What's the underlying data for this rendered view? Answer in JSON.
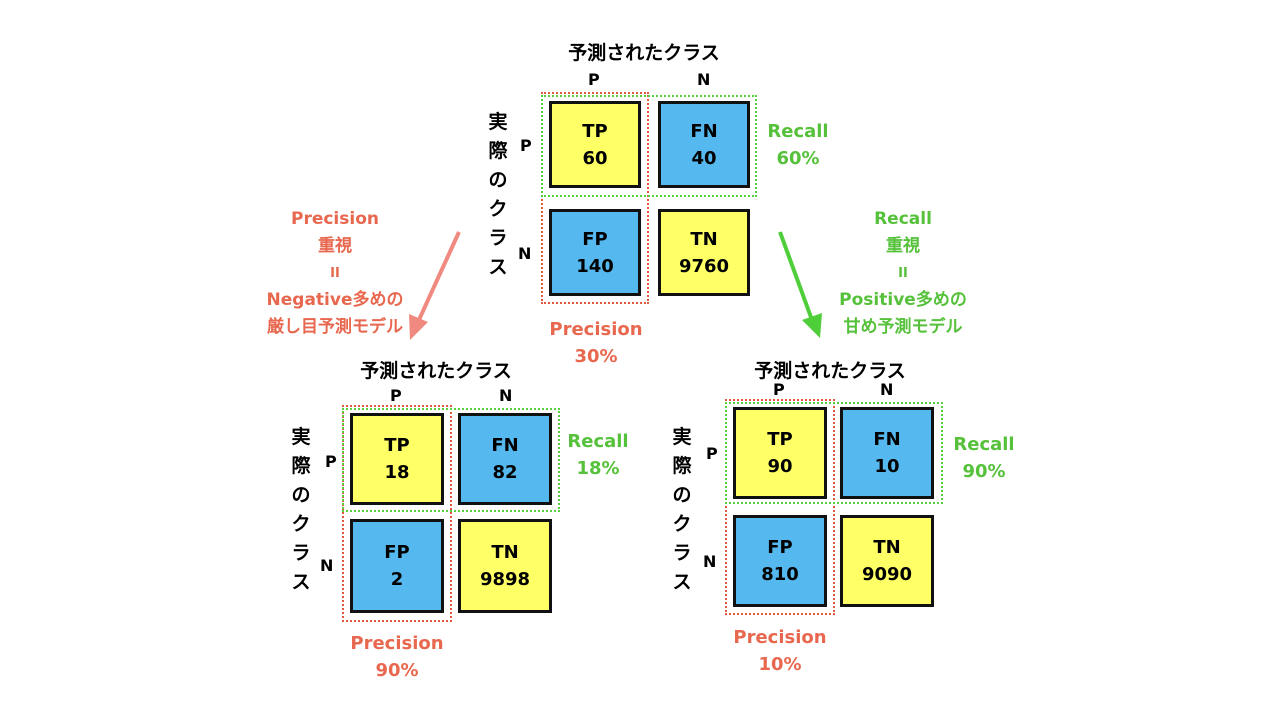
{
  "colors": {
    "yellow": "#ffff66",
    "blue": "#55b9ef",
    "recall_green": "#56c13a",
    "precision_red": "#e8684f",
    "arrow_red": "#f08a80",
    "arrow_green": "#4ecf3a"
  },
  "matrices": {
    "top": {
      "title": "予測されたクラス",
      "col_p": "P",
      "col_n": "N",
      "row_p": "P",
      "row_n": "N",
      "actual": [
        "実",
        "際",
        "の",
        "ク",
        "ラ",
        "ス"
      ],
      "tp_label": "TP",
      "tp": "60",
      "fn_label": "FN",
      "fn": "40",
      "fp_label": "FP",
      "fp": "140",
      "tn_label": "TN",
      "tn": "9760",
      "recall_label": "Recall",
      "recall": "60%",
      "precision_label": "Precision",
      "precision": "30%"
    },
    "left": {
      "title": "予測されたクラス",
      "col_p": "P",
      "col_n": "N",
      "row_p": "P",
      "row_n": "N",
      "actual": [
        "実",
        "際",
        "の",
        "ク",
        "ラ",
        "ス"
      ],
      "tp_label": "TP",
      "tp": "18",
      "fn_label": "FN",
      "fn": "82",
      "fp_label": "FP",
      "fp": "2",
      "tn_label": "TN",
      "tn": "9898",
      "recall_label": "Recall",
      "recall": "18%",
      "precision_label": "Precision",
      "precision": "90%"
    },
    "right": {
      "title": "予測されたクラス",
      "col_p": "P",
      "col_n": "N",
      "row_p": "P",
      "row_n": "N",
      "actual": [
        "実",
        "際",
        "の",
        "ク",
        "ラ",
        "ス"
      ],
      "tp_label": "TP",
      "tp": "90",
      "fn_label": "FN",
      "fn": "10",
      "fp_label": "FP",
      "fp": "810",
      "tn_label": "TN",
      "tn": "9090",
      "recall_label": "Recall",
      "recall": "90%",
      "precision_label": "Precision",
      "precision": "10%"
    }
  },
  "notes": {
    "left": [
      "Precision",
      "重視",
      "II",
      "Negative多めの",
      "厳し目予測モデル"
    ],
    "right": [
      "Recall",
      "重視",
      "II",
      "Positive多めの",
      "甘め予測モデル"
    ]
  }
}
